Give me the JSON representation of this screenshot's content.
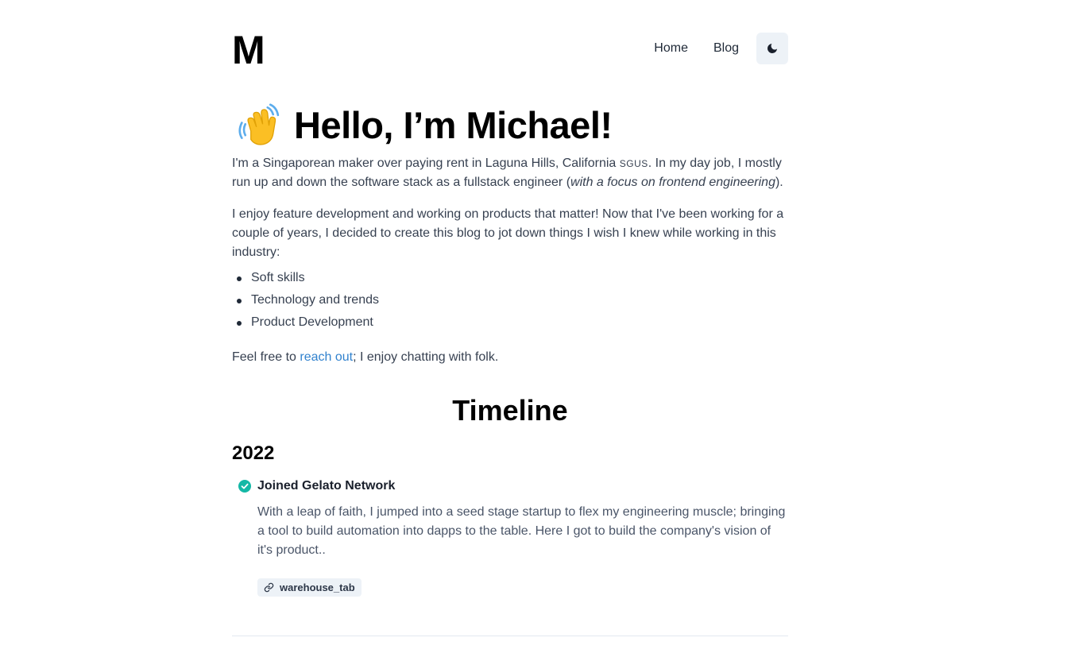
{
  "header": {
    "logo": "M",
    "nav": {
      "home": "Home",
      "blog": "Blog"
    },
    "theme_toggle_icon": "moon-icon"
  },
  "hero": {
    "emoji_icon": "waving-hand-icon",
    "title": "Hello, I’m Michael!"
  },
  "intro": {
    "p1_start": "I'm a Singaporean maker over paying rent in Laguna Hills, California ",
    "p1_sgus": "SGUS",
    "p1_mid": ". In my day job, I mostly run up and down the software stack as a fullstack engineer (",
    "p1_em": "with a focus on frontend engineering",
    "p1_end": ").",
    "p2": "I enjoy feature development and working on products that matter! Now that I've been working for a couple of years, I decided to create this blog to jot down things I wish I knew while working in this industry:",
    "topics": [
      "Soft skills",
      "Technology and trends",
      "Product Development"
    ],
    "p3_start": "Feel free to ",
    "p3_link": "reach out",
    "p3_end": "; I enjoy chatting with folk."
  },
  "timeline": {
    "title": "Timeline",
    "years": [
      {
        "year": "2022",
        "items": [
          {
            "title": "Joined Gelato Network",
            "description": "With a leap of faith, I jumped into a seed stage startup to flex my engineering muscle; bringing a tool to build automation into dapps to the table. Here I got to build the company's vision of it's product..",
            "tag": "warehouse_tab"
          }
        ]
      }
    ]
  },
  "colors": {
    "link": "#3182ce",
    "check": "#14b8a6",
    "button_bg": "#edf2f7"
  }
}
